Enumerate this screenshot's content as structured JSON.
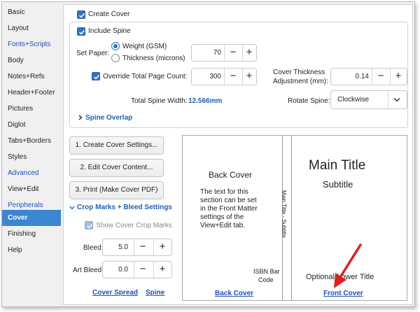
{
  "sidebar": {
    "items": [
      {
        "label": "Basic",
        "style": "normal"
      },
      {
        "label": "Layout",
        "style": "normal"
      },
      {
        "label": "Fonts+Scripts",
        "style": "blue"
      },
      {
        "label": "Body",
        "style": "normal"
      },
      {
        "label": "Notes+Refs",
        "style": "normal"
      },
      {
        "label": "Header+Footer",
        "style": "normal"
      },
      {
        "label": "Pictures",
        "style": "normal"
      },
      {
        "label": "Diglot",
        "style": "normal"
      },
      {
        "label": "Tabs+Borders",
        "style": "normal"
      },
      {
        "label": "Styles",
        "style": "normal"
      },
      {
        "label": "Advanced",
        "style": "blue"
      },
      {
        "label": "View+Edit",
        "style": "normal"
      },
      {
        "label": "Peripherals",
        "style": "blue"
      },
      {
        "label": "Cover",
        "style": "active"
      },
      {
        "label": "Finishing",
        "style": "normal"
      },
      {
        "label": "Help",
        "style": "normal"
      }
    ]
  },
  "cover": {
    "create_cover_label": "Create Cover",
    "include_spine_label": "Include Spine",
    "set_paper_label": "Set Paper:",
    "weight_label": "Weight (GSM)",
    "thickness_label": "Thickness (microns)",
    "paper_value": "70",
    "override_label": "Override Total Page Count:",
    "page_count_value": "300",
    "cover_thickness_label_1": "Cover Thickness",
    "cover_thickness_label_2": "Adjustment (mm):",
    "cover_thickness_value": "0.14",
    "total_spine_label": "Total Spine Width:",
    "total_spine_value": "12.566mm",
    "rotate_spine_label": "Rotate Spine:",
    "rotate_spine_value": "Clockwise",
    "spine_overlap_label": "Spine Overlap",
    "btn_settings": "1. Create Cover Settings...",
    "btn_edit": "2. Edit Cover Content...",
    "btn_print": "3. Print (Make Cover PDF)",
    "crop_marks_label": "Crop Marks + Bleed Settings",
    "show_crop_label": "Show Cover Crop Marks",
    "bleed_label": "Bleed:",
    "bleed_value": "5.0",
    "art_bleed_label": "Art Bleed:",
    "art_bleed_value": "0.0",
    "link_cover_spread": "Cover Spread",
    "link_spine": "Spine",
    "minus": "−",
    "plus": "+"
  },
  "preview": {
    "back_title": "Back Cover",
    "back_text": [
      "The text for this",
      "section can be set",
      "in the Front Matter",
      "settings of the",
      "View+Edit tab."
    ],
    "isbn_1": "ISBN Bar",
    "isbn_2": "Code",
    "back_link": "Back Cover",
    "spine_text": "Main Title  -  Subtitle",
    "main_title": "Main Title",
    "subtitle": "Subtitle",
    "optional_title": "Optional Lower Title",
    "front_link": "Front Cover"
  },
  "colors": {
    "accent": "#2f72cf",
    "sidebar_active": "#3a86d2",
    "arrow": "#e0201f"
  }
}
